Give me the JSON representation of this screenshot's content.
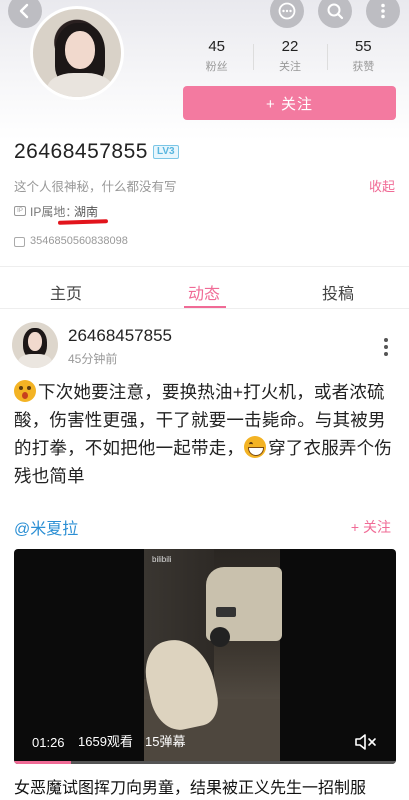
{
  "profile": {
    "username": "26468457855",
    "level_badge": "LV3",
    "signature": "这个人很神秘，什么都没有写",
    "collapse_label": "收起",
    "ip_label": "IP属地：",
    "ip_value": "湖南",
    "uid": "3546850560838098"
  },
  "stats": {
    "fans": {
      "value": "45",
      "label": "粉丝"
    },
    "following": {
      "value": "22",
      "label": "关注"
    },
    "likes": {
      "value": "55",
      "label": "获赞"
    }
  },
  "follow_button": "+ 关注",
  "tabs": [
    "主页",
    "动态",
    "投稿"
  ],
  "active_tab": "动态",
  "post": {
    "user": "26468457855",
    "time": "45分钟前",
    "text_1": "下次她要注意，要换热油+打火机，或者浓硫酸，伤害性更强，干了就要一击毙命。与其被男的打拳，不如把他一起带走，",
    "text_2": "穿了衣服弄个伤残也简单",
    "repost_user": "@米夏拉",
    "repost_follow": "+ 关注",
    "video": {
      "watermark": "bilibili",
      "duration": "01:26",
      "views": "1659观看",
      "danmaku": "15弹幕",
      "progress": 0.15
    },
    "video_title": "女恶魔试图挥刀向男童，结果被正义先生一招制服"
  },
  "icons": {
    "back": "back-arrow-icon",
    "chat": "more-chat-icon",
    "search": "search-icon",
    "more": "more-vertical-icon",
    "mute": "mute-icon"
  },
  "colors": {
    "accent": "#f06b96",
    "follow_bg": "#f37aa0",
    "link": "#2b8fd4",
    "highlight": "#e2141c"
  }
}
